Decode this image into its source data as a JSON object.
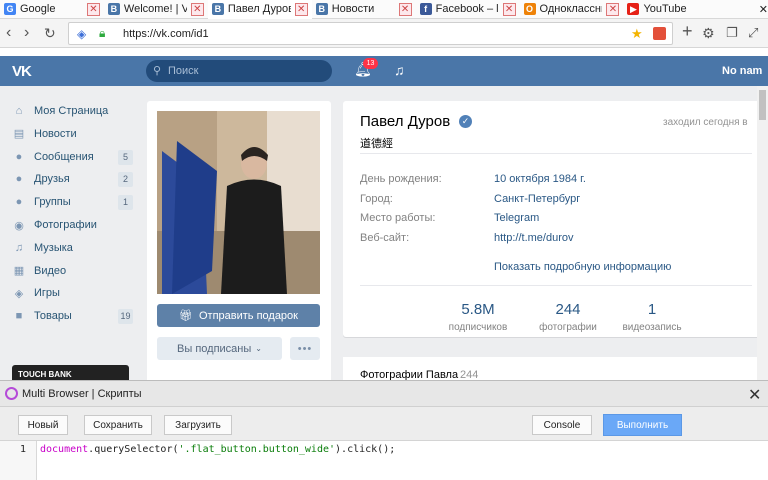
{
  "tabs": [
    {
      "label": "Google",
      "icon": "google-icon",
      "color": "#4285f4",
      "glyph": "G"
    },
    {
      "label": "Welcome! | VK",
      "icon": "vk-icon",
      "color": "#4a76a8",
      "glyph": "B"
    },
    {
      "label": "Павел Дуров",
      "icon": "vk-icon",
      "color": "#4a76a8",
      "glyph": "B"
    },
    {
      "label": "Новости",
      "icon": "vk-icon",
      "color": "#4a76a8",
      "glyph": "B"
    },
    {
      "label": "Facebook – log ...",
      "icon": "facebook-icon",
      "color": "#3b5998",
      "glyph": "f"
    },
    {
      "label": "Одноклассник...",
      "icon": "ok-icon",
      "color": "#ee8208",
      "glyph": "O"
    },
    {
      "label": "YouTube",
      "icon": "youtube-icon",
      "color": "#e62117",
      "glyph": "▶"
    }
  ],
  "address": {
    "url": "https://vk.com/id1"
  },
  "header": {
    "search_placeholder": "Поиск",
    "notifications_count": "13",
    "user_name": "No nam"
  },
  "sidebar": {
    "items": [
      {
        "label": "Моя Страница",
        "icon": "home-icon",
        "glyph": "⌂",
        "count": ""
      },
      {
        "label": "Новости",
        "icon": "news-icon",
        "glyph": "▤",
        "count": ""
      },
      {
        "label": "Сообщения",
        "icon": "messages-icon",
        "glyph": "●",
        "count": "5"
      },
      {
        "label": "Друзья",
        "icon": "friends-icon",
        "glyph": "●",
        "count": "2"
      },
      {
        "label": "Группы",
        "icon": "groups-icon",
        "glyph": "●",
        "count": "1"
      },
      {
        "label": "Фотографии",
        "icon": "photos-icon",
        "glyph": "◉",
        "count": ""
      },
      {
        "label": "Музыка",
        "icon": "music-icon",
        "glyph": "♫",
        "count": ""
      },
      {
        "label": "Видео",
        "icon": "video-icon",
        "glyph": "▦",
        "count": ""
      },
      {
        "label": "Игры",
        "icon": "games-icon",
        "glyph": "◈",
        "count": ""
      },
      {
        "label": "Товары",
        "icon": "goods-icon",
        "glyph": "■",
        "count": "19"
      }
    ],
    "ad_label": "TOUCH BANK"
  },
  "profile": {
    "name": "Павел Дуров",
    "status": "道德經",
    "online": "заходил сегодня в",
    "info": [
      {
        "key": "День рождения:",
        "value": "10 октября 1984 г."
      },
      {
        "key": "Город:",
        "value": "Санкт-Петербург"
      },
      {
        "key": "Место работы:",
        "value": "Telegram"
      },
      {
        "key": "Веб-сайт:",
        "value": "http://t.me/durov"
      }
    ],
    "more_info": "Показать подробную информацию",
    "counters": [
      {
        "value": "5.8M",
        "label": "подписчиков"
      },
      {
        "value": "244",
        "label": "фотографии"
      },
      {
        "value": "1",
        "label": "видеозапись"
      }
    ],
    "gift_button": "Отправить подарок",
    "subscribed_button": "Вы подписаны",
    "more_button": "•••",
    "photos_title": "Фотографии Павла",
    "photos_count": "244"
  },
  "panel": {
    "title": "Multi Browser | Скрипты",
    "buttons": {
      "new": "Новый",
      "save": "Сохранить",
      "load": "Загрузить",
      "console": "Console",
      "run": "Выполнить"
    },
    "editor": {
      "line_number": "1",
      "code_object": "document",
      "code_method": ".querySelector(",
      "code_string": "'.flat_button.button_wide'",
      "code_rest": ").click();"
    }
  },
  "colors": {
    "vk_blue": "#4a76a8",
    "link": "#2a5885",
    "run_button": "#6aa8f7"
  }
}
